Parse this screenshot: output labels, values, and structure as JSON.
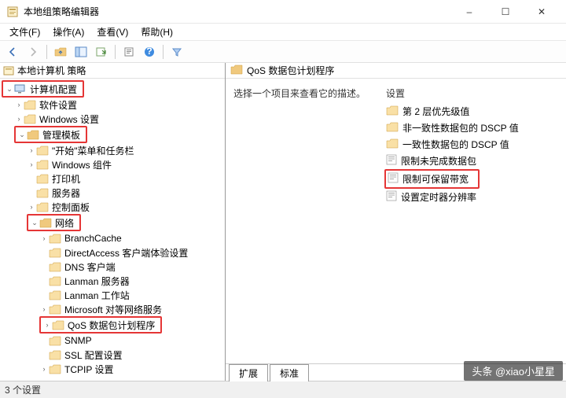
{
  "window": {
    "title": "本地组策略编辑器",
    "min_label": "–",
    "max_label": "☐",
    "close_label": "✕"
  },
  "menu": {
    "file": "文件(F)",
    "action": "操作(A)",
    "view": "查看(V)",
    "help": "帮助(H)"
  },
  "tree": {
    "root": "本地计算机 策略",
    "computer_config": "计算机配置",
    "software": "软件设置",
    "windows_settings": "Windows 设置",
    "admin_templates": "管理模板",
    "start_taskbar": "\"开始\"菜单和任务栏",
    "windows_components": "Windows 组件",
    "printers": "打印机",
    "servers": "服务器",
    "control_panel": "控制面板",
    "network": "网络",
    "branchcache": "BranchCache",
    "directaccess": "DirectAccess 客户端体验设置",
    "dns_client": "DNS 客户端",
    "lanman_server": "Lanman 服务器",
    "lanman_workstation": "Lanman 工作站",
    "ms_peer": "Microsoft 对等网络服务",
    "qos": "QoS 数据包计划程序",
    "snmp": "SNMP",
    "ssl": "SSL 配置设置",
    "tcpip": "TCPIP 设置"
  },
  "right": {
    "header_title": "QoS 数据包计划程序",
    "select_prompt": "选择一个项目来查看它的描述。",
    "settings_label": "设置",
    "items": {
      "layer2": "第 2 层优先级值",
      "dscp_non": "非一致性数据包的 DSCP 值",
      "dscp_con": "一致性数据包的 DSCP 值",
      "limit_unfinished": "限制未完成数据包",
      "limit_reservable": "限制可保留带宽",
      "timer_res": "设置定时器分辨率"
    },
    "tabs": {
      "extended": "扩展",
      "standard": "标准"
    }
  },
  "status": {
    "text": "3 个设置"
  },
  "watermark": {
    "text": "头条 @xiao小星星"
  }
}
